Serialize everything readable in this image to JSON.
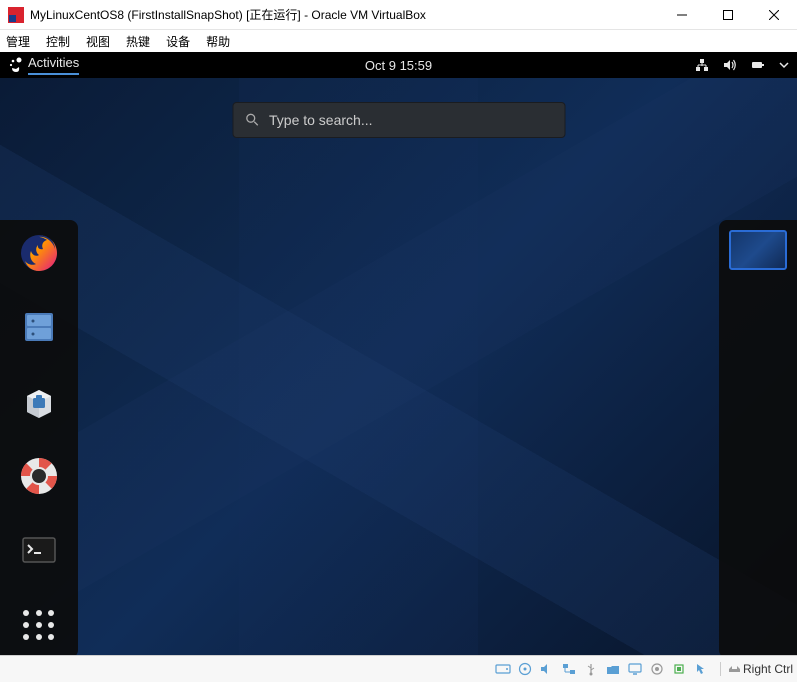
{
  "window": {
    "title": "MyLinuxCentOS8 (FirstInstallSnapShot) [正在运行] - Oracle VM VirtualBox",
    "controls": {
      "min": "minimize",
      "max": "maximize",
      "close": "close"
    }
  },
  "vb_menu": [
    "管理",
    "控制",
    "视图",
    "热键",
    "设备",
    "帮助"
  ],
  "gnome": {
    "activities": "Activities",
    "clock": "Oct 9  15:59",
    "search_placeholder": "Type to search...",
    "status": {
      "network": "wired",
      "sound": "on",
      "battery": "full"
    }
  },
  "dash": [
    {
      "id": "firefox",
      "icon": "firefox-icon"
    },
    {
      "id": "files",
      "icon": "files-icon"
    },
    {
      "id": "software",
      "icon": "software-icon"
    },
    {
      "id": "help",
      "icon": "help-icon"
    },
    {
      "id": "terminal",
      "icon": "terminal-icon"
    },
    {
      "id": "app-grid",
      "icon": "grid-icon"
    }
  ],
  "vb_status": {
    "icons": [
      "hdd",
      "optical",
      "audio",
      "network",
      "usb",
      "shared",
      "display",
      "recording",
      "processor"
    ],
    "host_key": "Right Ctrl"
  }
}
